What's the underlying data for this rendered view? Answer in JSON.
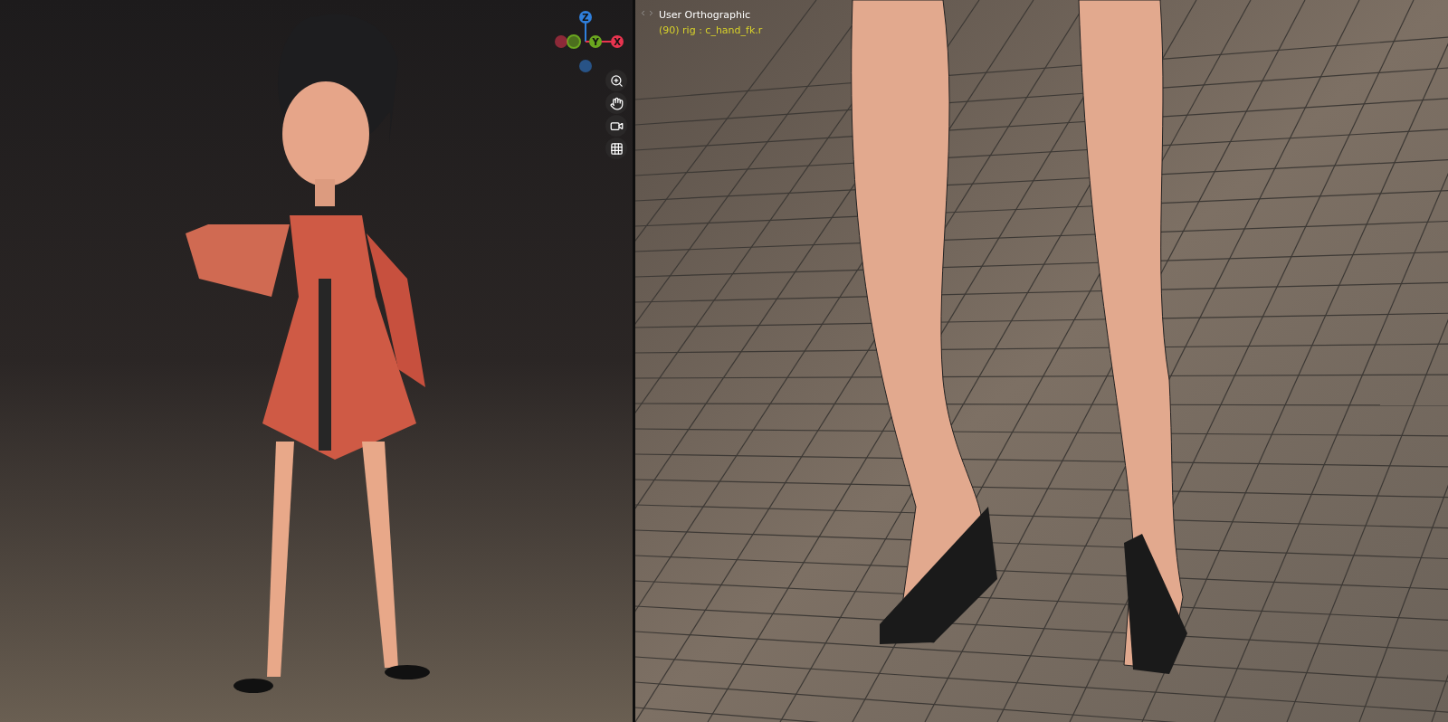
{
  "left_viewport": {
    "kind": "rendered",
    "gizmo": {
      "axes": [
        {
          "label": "Z",
          "color": "#2f7fdc"
        },
        {
          "label": "Y",
          "color": "#6aa61f"
        },
        {
          "label": "X",
          "color": "#e8344f"
        }
      ]
    }
  },
  "right_viewport": {
    "kind": "wireframe",
    "view_name": "User Orthographic",
    "active_object": "(90) rig : c_hand_fk.r"
  }
}
